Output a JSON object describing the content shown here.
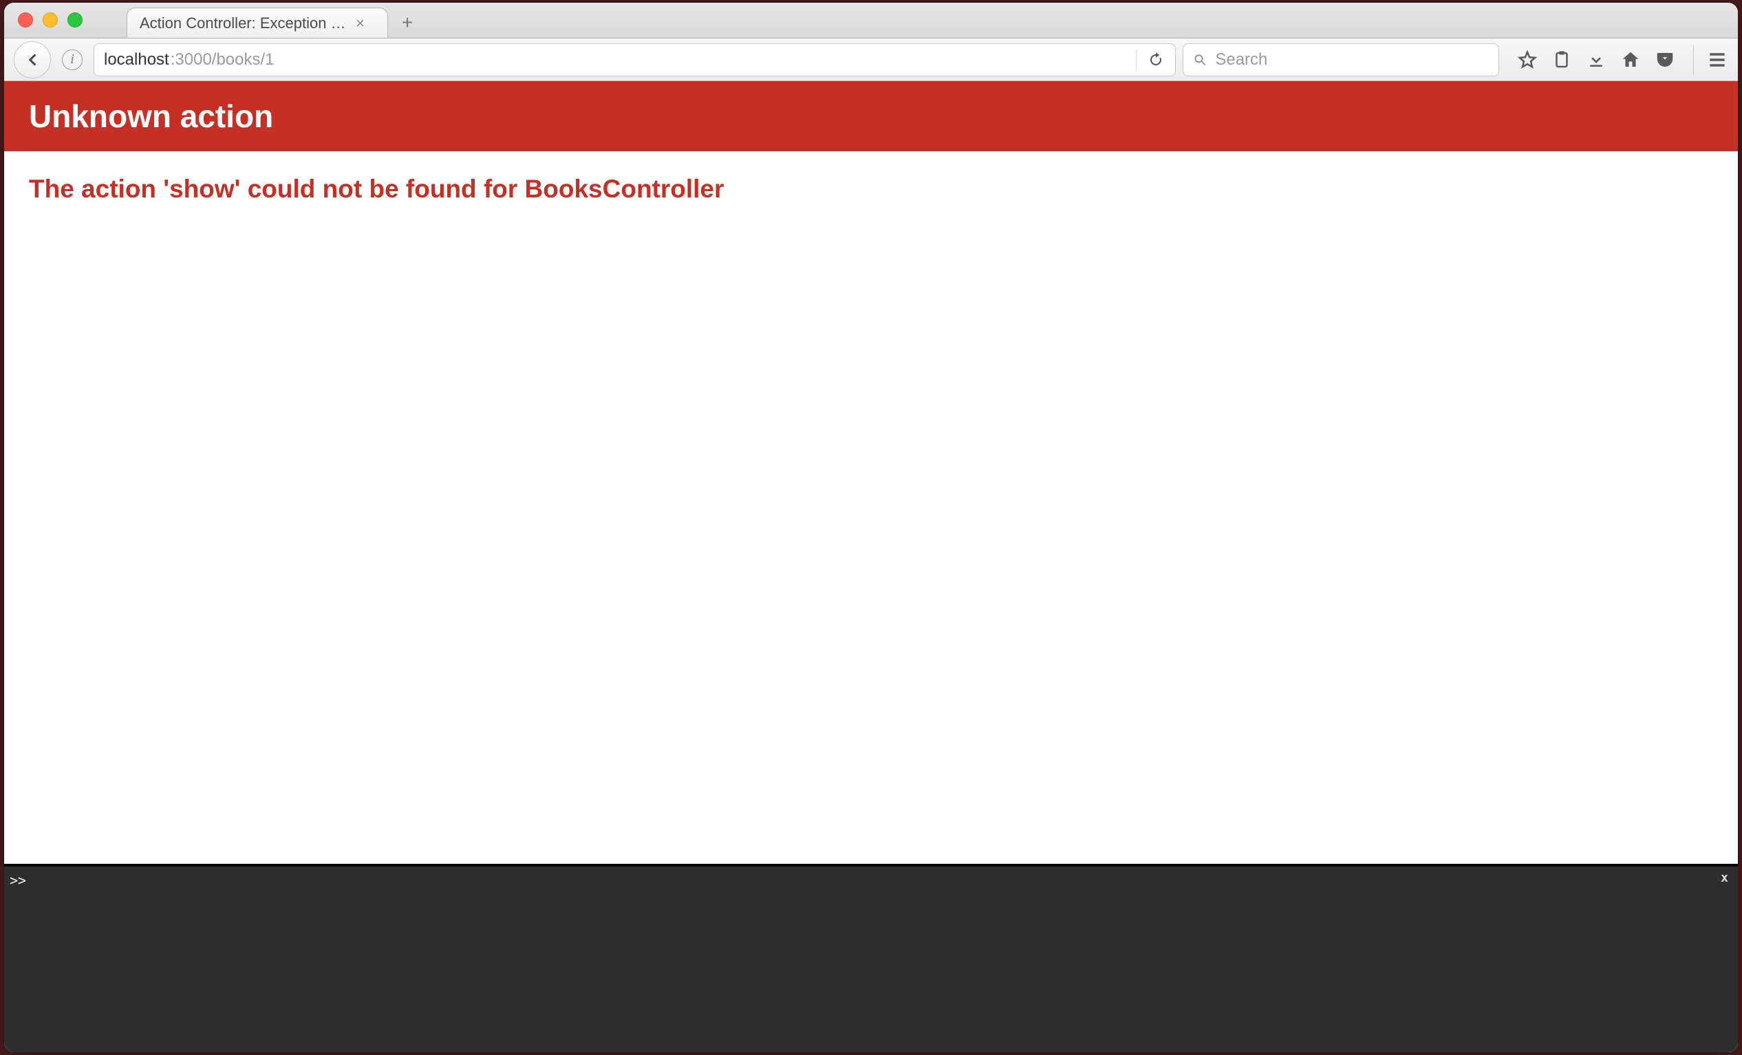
{
  "window": {
    "tab_title": "Action Controller: Exception ca...",
    "url_host": "localhost",
    "url_rest": ":3000/books/1"
  },
  "toolbar": {
    "search_placeholder": "Search",
    "info_label": "i"
  },
  "page": {
    "banner_title": "Unknown action",
    "error_message": "The action 'show' could not be found for BooksController"
  },
  "console": {
    "prompt": ">>",
    "close_label": "x"
  }
}
